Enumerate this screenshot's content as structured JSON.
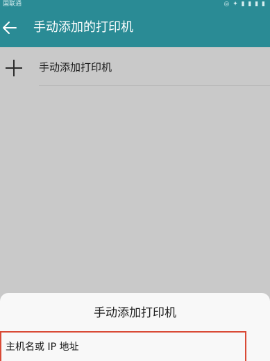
{
  "status_bar": {
    "carrier": "国联通",
    "indicators": "◎ ✦ ▮ ▮ ▮ ▮"
  },
  "header": {
    "title": "手动添加的打印机"
  },
  "list": {
    "items": [
      {
        "label": "手动添加打印机",
        "icon": "plus-icon"
      }
    ]
  },
  "sheet": {
    "title": "手动添加打印机",
    "field_label": "主机名或 IP 地址"
  },
  "colors": {
    "accent": "#2a8b95",
    "highlight_border": "#d94a36",
    "scrim": "#c9c9c9",
    "sheet_background": "#f8f8f8"
  }
}
